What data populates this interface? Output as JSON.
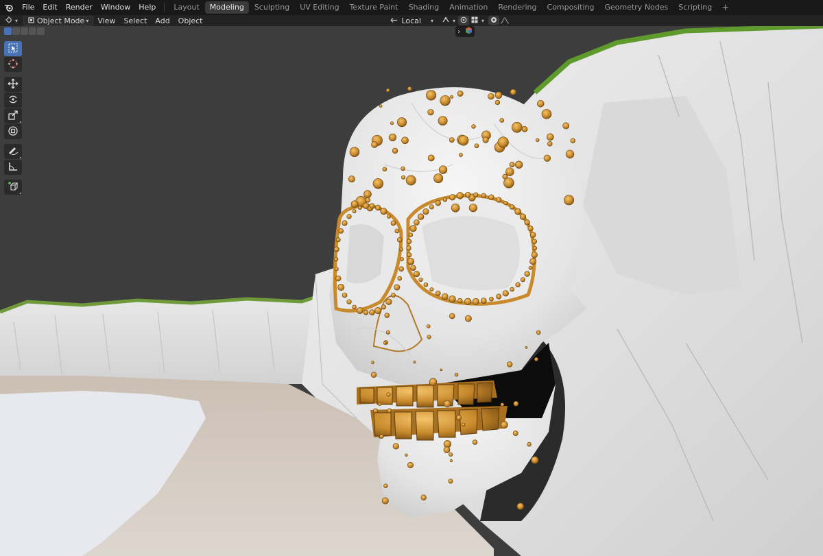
{
  "menubar": {
    "items": [
      "File",
      "Edit",
      "Render",
      "Window",
      "Help"
    ],
    "workspaces": [
      "Layout",
      "Modeling",
      "Sculpting",
      "UV Editing",
      "Texture Paint",
      "Shading",
      "Animation",
      "Rendering",
      "Compositing",
      "Geometry Nodes",
      "Scripting"
    ],
    "active_workspace": "Modeling",
    "add_tab": "+"
  },
  "header": {
    "mode": "Object Mode",
    "menus": [
      "View",
      "Select",
      "Add",
      "Object"
    ],
    "pivot": "Local"
  },
  "toolbar": {
    "tools": [
      "select-box",
      "cursor",
      "move",
      "rotate",
      "scale",
      "transform",
      "annotate",
      "measure",
      "add-cube"
    ],
    "active": "select-box"
  },
  "icons": [
    "blender-logo-icon",
    "editor-type-icon",
    "object-mode-icon",
    "transform-orientation-icon",
    "snap-icon",
    "proportional-edit-icon",
    "overlay-icon",
    "shading-icon",
    "gizmo-icon"
  ],
  "colors": {
    "accent": "#4772b3",
    "topbar": "#181818",
    "header": "#232323",
    "viewport": "#3d3d3d",
    "gold": "#c88a2c"
  }
}
